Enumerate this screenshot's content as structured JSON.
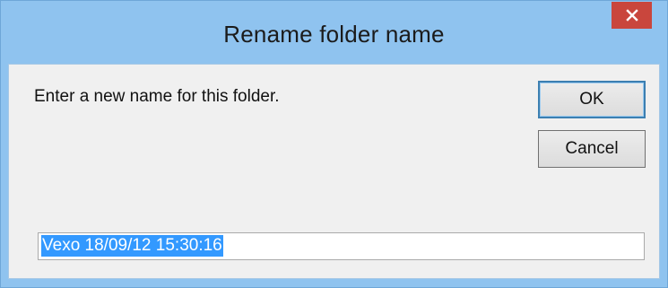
{
  "window": {
    "title": "Rename folder name",
    "close_icon": "close-icon"
  },
  "dialog": {
    "prompt": "Enter a new name for this folder.",
    "ok_label": "OK",
    "cancel_label": "Cancel",
    "name_value": "Vexo 18/09/12 15:30:16",
    "name_value_selected": true
  },
  "colors": {
    "titlebar": "#8fc3ef",
    "close_button": "#c9463d",
    "client_bg": "#f0f0f0",
    "selection": "#3399ff"
  }
}
